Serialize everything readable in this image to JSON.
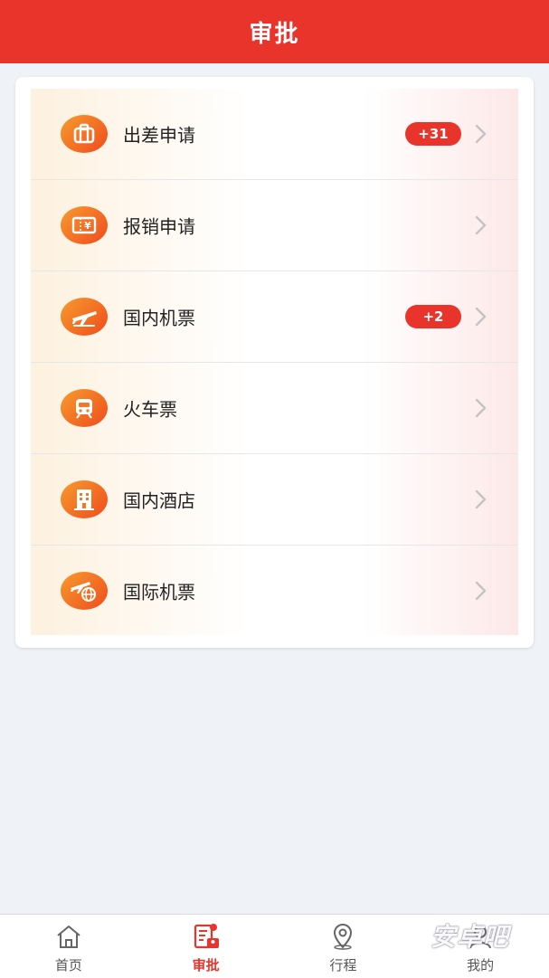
{
  "header": {
    "title": "审批"
  },
  "items": [
    {
      "label": "出差申请",
      "badge": "+31",
      "icon": "suitcase-icon"
    },
    {
      "label": "报销申请",
      "badge": "",
      "icon": "receipt-yen-icon"
    },
    {
      "label": "国内机票",
      "badge": "+2",
      "icon": "airplane-icon"
    },
    {
      "label": "火车票",
      "badge": "",
      "icon": "train-icon"
    },
    {
      "label": "国内酒店",
      "badge": "",
      "icon": "hotel-building-icon"
    },
    {
      "label": "国际机票",
      "badge": "",
      "icon": "globe-airplane-icon"
    }
  ],
  "tabbar": {
    "tabs": [
      {
        "label": "首页",
        "icon": "home-icon",
        "active": false
      },
      {
        "label": "审批",
        "icon": "approval-document-icon",
        "active": true
      },
      {
        "label": "行程",
        "icon": "location-pin-icon",
        "active": false
      },
      {
        "label": "我的",
        "icon": "profile-icon",
        "active": false
      }
    ]
  },
  "watermark": {
    "text": "安卓吧"
  },
  "colors": {
    "brand_red": "#e8342b",
    "icon_orange": "#f79b2e",
    "background": "#eff2f6"
  }
}
